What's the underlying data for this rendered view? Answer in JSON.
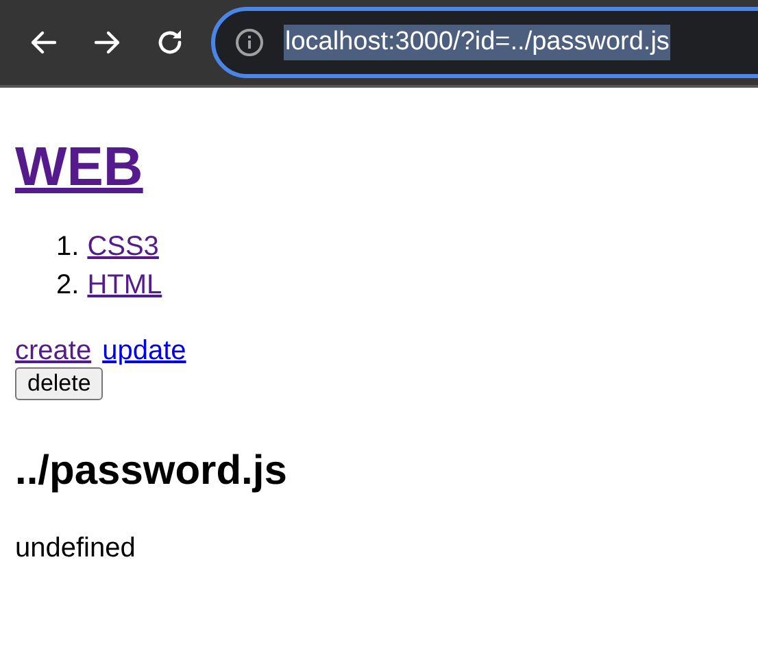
{
  "browser": {
    "url": "localhost:3000/?id=../password.js",
    "url_selected": true
  },
  "page": {
    "title": {
      "text": "WEB",
      "visited": true
    },
    "topics": [
      {
        "number": "1.",
        "label": "CSS3",
        "visited": true
      },
      {
        "number": "2.",
        "label": "HTML",
        "visited": true
      }
    ],
    "actions": [
      {
        "label": "create",
        "visited": true
      },
      {
        "label": "update",
        "visited": false
      }
    ],
    "delete_button": "delete",
    "heading": "../password.js",
    "body": "undefined"
  }
}
